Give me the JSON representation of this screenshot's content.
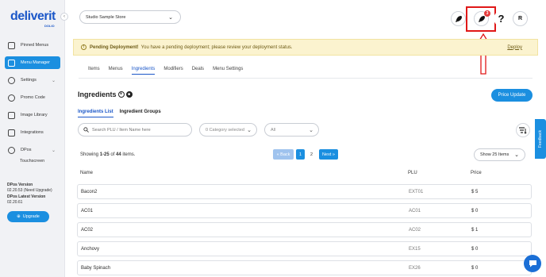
{
  "brand": {
    "name": "deliverit",
    "sub": "DOLIO"
  },
  "sidebar": {
    "items": [
      {
        "label": "Pinned Menus",
        "icon": "pin-icon"
      },
      {
        "label": "Menu Manager",
        "icon": "menu-icon",
        "active": true
      },
      {
        "label": "Settings",
        "icon": "gear-icon",
        "expandable": true
      },
      {
        "label": "Promo Code",
        "icon": "promo-icon"
      },
      {
        "label": "Image Library",
        "icon": "image-icon"
      },
      {
        "label": "Integrations",
        "icon": "integration-icon"
      },
      {
        "label": "DPos",
        "icon": "pos-icon",
        "expandable": true
      }
    ],
    "sub_item": "Touchscreen",
    "version_label": "DPos Version",
    "version_value": "02.20.53 (Need Upgrade)",
    "latest_label": "DPos Latest Version",
    "latest_value": "02.20.61",
    "upgrade_label": "Upgrade"
  },
  "topbar": {
    "store": "Studio Sample Store",
    "notification_count": "3",
    "help": "?",
    "avatar": "R"
  },
  "alert": {
    "title": "Pending Deployment!",
    "message": "You have a pending deployment; please review your deployment status.",
    "link": "Deploy"
  },
  "tabs": [
    "Items",
    "Menus",
    "Ingredients",
    "Modifiers",
    "Deals",
    "Menu Settings"
  ],
  "section": {
    "title": "Ingredients",
    "price_update": "Price Update",
    "subtabs": [
      "Ingredients List",
      "Ingredient Groups"
    ]
  },
  "filters": {
    "search_placeholder": "Search PLU / Item Name here",
    "category": "0 Category selected",
    "all": "All"
  },
  "pagination": {
    "showing_prefix": "Showing ",
    "range": "1-25",
    "of": " of ",
    "total": "44",
    "suffix": " items.",
    "back": "« Back",
    "page1": "1",
    "page2": "2",
    "next": "Next »",
    "page_size": "Show 25 Items"
  },
  "table": {
    "columns": [
      "Name",
      "PLU",
      "Price"
    ],
    "rows": [
      {
        "name": "Bacon2",
        "plu": "EXT01",
        "price": "$ 5"
      },
      {
        "name": "AC01",
        "plu": "AC01",
        "price": "$ 0"
      },
      {
        "name": "AC02",
        "plu": "AC02",
        "price": "$ 1"
      },
      {
        "name": "Anchovy",
        "plu": "EX15",
        "price": "$ 0"
      },
      {
        "name": "Baby Spinach",
        "plu": "EX26",
        "price": "$ 0"
      }
    ]
  },
  "feedback": "Feedback",
  "colors": {
    "accent": "#1b8fe0",
    "brand": "#1b57c8",
    "alert_bg": "#fbf3cf",
    "highlight": "#e01818"
  }
}
